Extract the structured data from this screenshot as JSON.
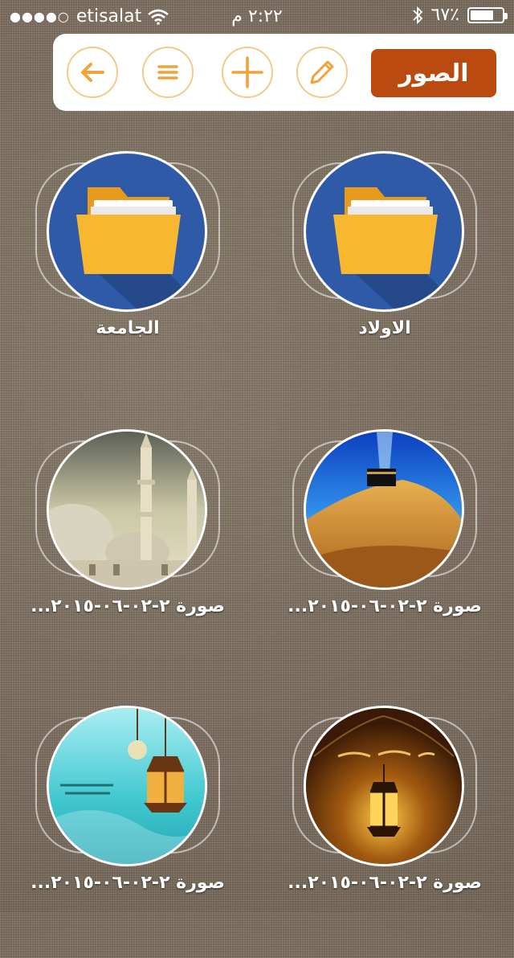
{
  "status_bar": {
    "carrier": "etisalat",
    "time": "٢:٢٢ م",
    "battery": "٦٧٪",
    "battery_level": 0.67
  },
  "toolbar": {
    "title": "الصور",
    "icons": [
      "back-arrow-icon",
      "menu-icon",
      "add-icon",
      "edit-icon"
    ],
    "accent": "#bb4a10",
    "icon_color": "#f0a33a"
  },
  "grid": {
    "items": [
      {
        "label": "الاولاد",
        "type": "folder"
      },
      {
        "label": "الجامعة",
        "type": "folder"
      },
      {
        "label": "صورة ٢-٠٢-٠٦-٢٠١٥...",
        "type": "photo",
        "subject": "kaaba-desert"
      },
      {
        "label": "صورة ٢-٠٢-٠٦-٢٠١٥...",
        "type": "photo",
        "subject": "mosque-minarets"
      },
      {
        "label": "صورة ٢-٠٢-٠٦-٢٠١٥...",
        "type": "photo",
        "subject": "ramadan-lantern-gold"
      },
      {
        "label": "صورة ٢-٠٢-٠٦-٢٠١٥...",
        "type": "photo",
        "subject": "ramadan-lantern-teal"
      }
    ],
    "folder_colors": {
      "circle": "#2f5aa8",
      "folder": "#f5b324"
    }
  }
}
